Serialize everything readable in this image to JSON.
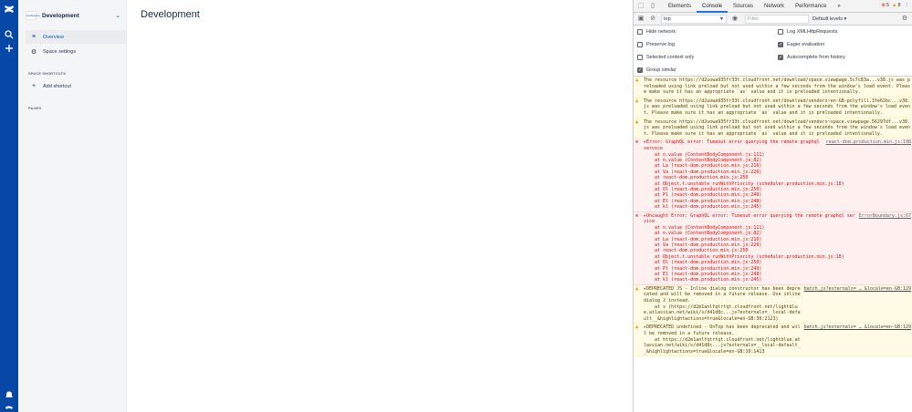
{
  "sidebar": {
    "space_name": "Development",
    "logo_text": "confluence",
    "nav": [
      {
        "label": "Overview",
        "icon": "list-icon",
        "active": true
      },
      {
        "label": "Space settings",
        "icon": "gear-icon",
        "active": false
      }
    ],
    "shortcuts_heading": "SPACE SHORTCUTS",
    "add_shortcut": "Add shortcut",
    "pages_heading": "PAGES"
  },
  "main": {
    "title": "Development"
  },
  "devtools": {
    "tabs": [
      "Elements",
      "Console",
      "Sources",
      "Network",
      "Performance"
    ],
    "active_tab": "Console",
    "more": "»",
    "error_count": "5",
    "warning_count": "8",
    "context": "top",
    "filter_placeholder": "Filter",
    "levels": "Default levels ▾",
    "settings": {
      "hide_network": "Hide network",
      "preserve_log": "Preserve log",
      "selected_context": "Selected context only",
      "group_similar": "Group similar",
      "log_xhr": "Log XMLHttpRequests",
      "eager_eval": "Eager evaluation",
      "autocomplete": "Autocomplete from history"
    },
    "messages": [
      {
        "type": "warn",
        "text": "The resource https://d2uowa935fr33t.cloudfront.net/download/space.viewpage.5c7c83a...v38.js was preloaded using link preload but not used within a few seconds from the window's load event. Please make sure it has an appropriate `as` value and it is preloaded intentionally."
      },
      {
        "type": "warn",
        "text": "The resource https://d2uowa935fr33t.cloudfront.net/download/vendors~en-GB-polyfill.3fe62bc...v38.js was preloaded using link preload but not used within a few seconds from the window's load event. Please make sure it has an appropriate `as` value and it is preloaded intentionally."
      },
      {
        "type": "warn",
        "text": "The resource https://d2uowa935fr33t.cloudfront.net/download/vendors~space.viewpage.56297df...v38.js was preloaded using link preload but not used within a few seconds from the window's load event. Please make sure it has an appropriate `as` value and it is preloaded intentionally."
      },
      {
        "type": "error",
        "text": "▸Error: GraphQL error: Timeout error querying the remote graphql service",
        "source": "react-dom.production.min.js:198",
        "stack": [
          "at n.value (ContentBodyComponent.js:111)",
          "at n.value (ContentBodyComponent.js:82)",
          "at La (react-dom.production.min.js:216)",
          "at Va (react-dom.production.min.js:220)",
          "at react-dom.production.min.js:250",
          "at Object.t.unstable_runWithPriority (scheduler.production.min.js:18)",
          "at Ol (react-dom.production.min.js:250)",
          "at Pl (react-dom.production.min.js:249)",
          "at El (react-dom.production.min.js:248)",
          "at kl (react-dom.production.min.js:245)"
        ]
      },
      {
        "type": "error",
        "text": "▸Uncaught Error: GraphQL error: Timeout error querying the remote graphql service",
        "source": "ErrorBoundary.js:67",
        "stack": [
          "at n.value (ContentBodyComponent.js:111)",
          "at n.value (ContentBodyComponent.js:82)",
          "at La (react-dom.production.min.js:216)",
          "at Va (react-dom.production.min.js:220)",
          "at react-dom.production.min.js:250",
          "at Object.t.unstable_runWithPriority (scheduler.production.min.js:18)",
          "at Ol (react-dom.production.min.js:250)",
          "at Pl (react-dom.production.min.js:249)",
          "at El (react-dom.production.min.js:248)",
          "at kl (react-dom.production.min.js:245)"
        ]
      },
      {
        "type": "warn",
        "text": "▸DEPRECATED JS - Inline dialog constructor has been deprecated and will be removed in a future release. Use inline dialog 2 instead.\n    at v (https://d2m1anlfqtrtqt.cloudfront.net/lightblue.atlassian.net/wiki/s/d41d8c...js?externals=__local-default__&highlightactions=true&locale=en-GB:30:2123)",
        "source": "batch.js?externals=_…_&locale=en-GB:129"
      },
      {
        "type": "warn",
        "text": "▸DEPRECATED undefined - OnTop has been deprecated and will be removed in a future release.\n    at https://d2m1anlfqtrtqt.cloudfront.net/lightblue.atlassian.net/wiki/s/d41d8c...js?externals=__local-default__&highlightactions=true&locale=en-GB:10:1413",
        "source": "batch.js?externals=_…_&locale=en-GB:129"
      }
    ]
  },
  "colors": {
    "global_nav": "#0747a6",
    "sidebar_bg": "#f4f5f7",
    "accent": "#0052cc",
    "warn_bg": "#fffbe5",
    "error_bg": "#fff0f0"
  }
}
